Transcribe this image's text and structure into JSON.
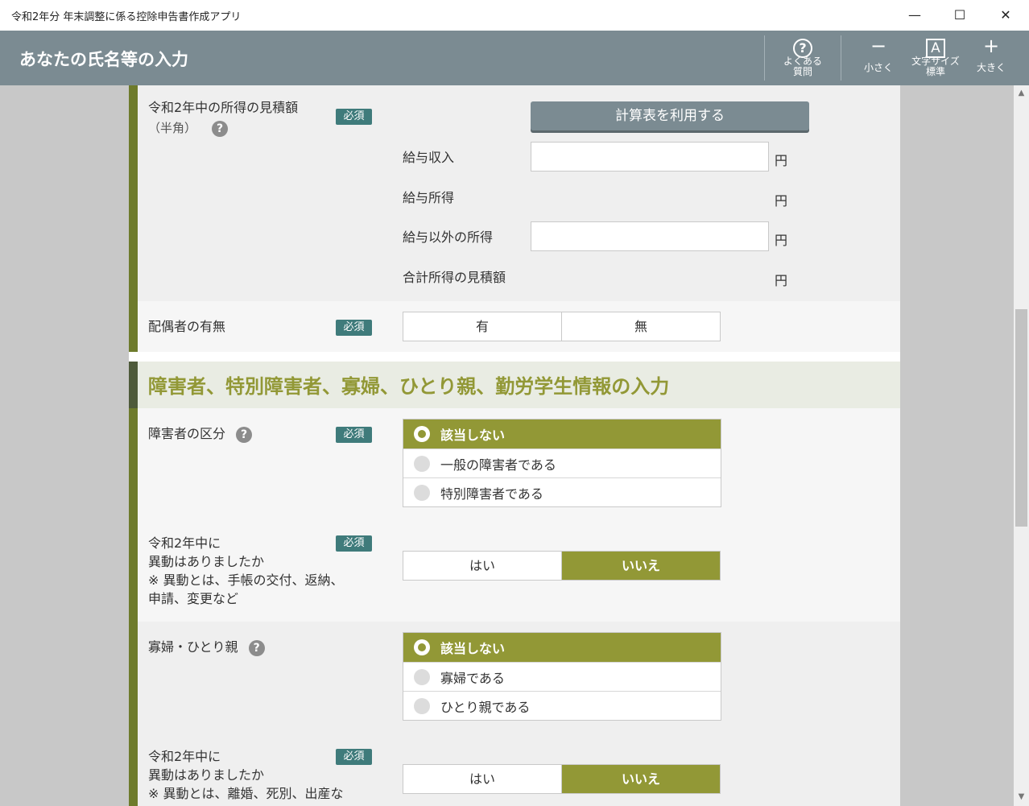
{
  "window": {
    "title": "令和2年分 年末調整に係る控除申告書作成アプリ",
    "min_glyph": "—",
    "max_glyph": "☐",
    "close_glyph": "✕"
  },
  "header": {
    "page_title": "あなたの氏名等の入力",
    "faq_glyph": "?",
    "faq_line1": "よくある",
    "faq_line2": "質問",
    "smaller_glyph": "−",
    "smaller_label": "小さく",
    "fontsize_glyph": "A",
    "fontsize_line1": "文字サイズ",
    "fontsize_line2": "標準",
    "bigger_glyph": "+",
    "bigger_label": "大きく"
  },
  "required_label": "必須",
  "help_glyph": "?",
  "income": {
    "label": "令和2年中の所得の見積額",
    "sub": "（半角）",
    "calc_button": "計算表を利用する",
    "salary_income_label": "給与収入",
    "salary_income_value": "",
    "salary_deduct_label": "給与所得",
    "other_income_label": "給与以外の所得",
    "other_income_value": "",
    "total_label": "合計所得の見積額",
    "yen": "円"
  },
  "spouse": {
    "label": "配偶者の有無",
    "yes": "有",
    "no": "無"
  },
  "section2": {
    "heading": "障害者、特別障害者、寡婦、ひとり親、勤労学生情報の入力"
  },
  "disability": {
    "label": "障害者の区分",
    "options": [
      "該当しない",
      "一般の障害者である",
      "特別障害者である"
    ],
    "change_line1": "令和2年中に",
    "change_line2": "異動はありましたか",
    "change_note1": "※ 異動とは、手帳の交付、返納、",
    "change_note2": "申請、変更など",
    "yes": "はい",
    "no": "いいえ"
  },
  "widow": {
    "label": "寡婦・ひとり親",
    "options": [
      "該当しない",
      "寡婦である",
      "ひとり親である"
    ],
    "change_line1": "令和2年中に",
    "change_line2": "異動はありましたか",
    "change_note1": "※ 異動とは、離婚、死別、出産な",
    "yes": "はい",
    "no": "いいえ"
  }
}
